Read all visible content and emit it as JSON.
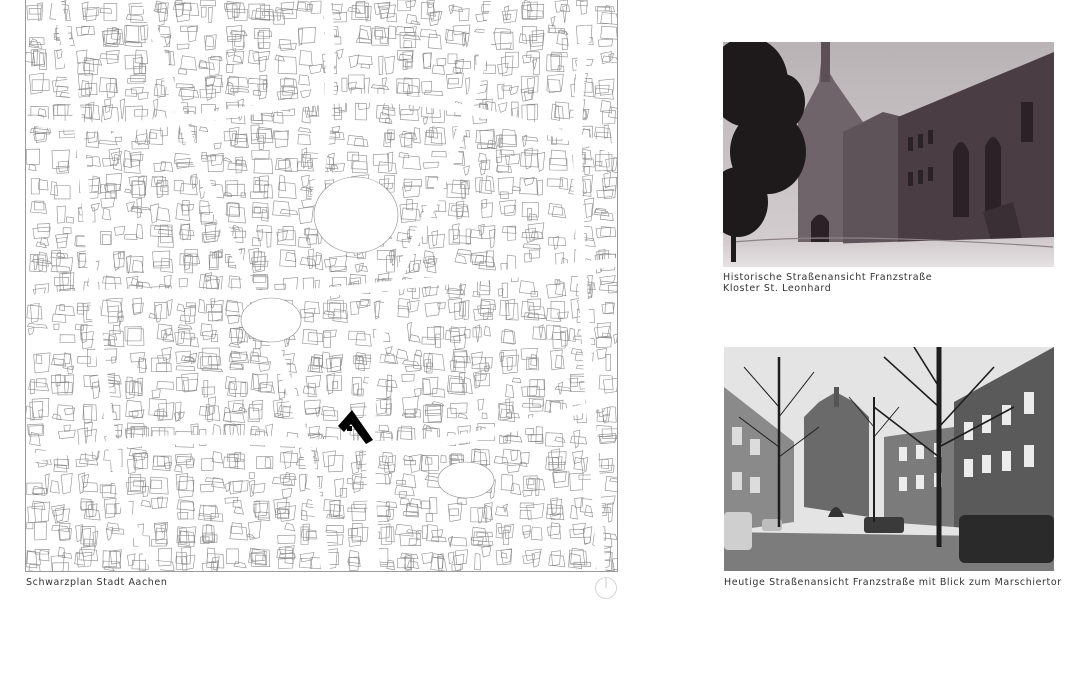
{
  "map": {
    "caption": "Schwarzplan Stadt Aachen"
  },
  "photos": [
    {
      "caption_line1": "Historische Straßenansicht Franzstraße",
      "caption_line2": "Kloster St. Leonhard"
    },
    {
      "caption": "Heutige Straßenansicht Franzstraße mit Blick zum Marschiertor"
    }
  ],
  "icons": {
    "north_arrow": "north-arrow-icon"
  },
  "colors": {
    "map_lines": "#8c8c8c",
    "building_highlight": "#000000",
    "photo1_tint": "#3a2a33",
    "photo2_tone": "#5a5a5a"
  }
}
